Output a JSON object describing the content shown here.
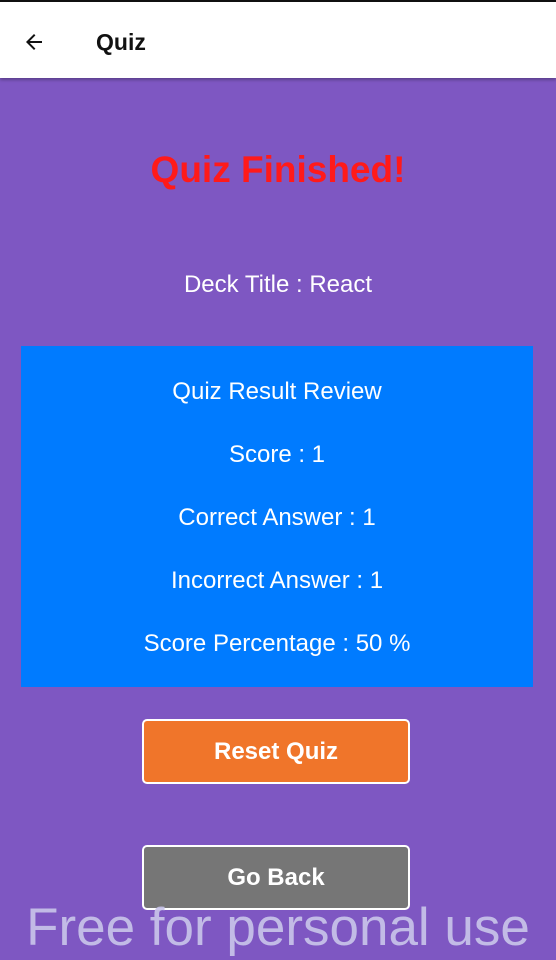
{
  "header": {
    "back_icon": "arrow-left-icon",
    "title": "Quiz"
  },
  "main": {
    "heading": "Quiz Finished!",
    "deck_title": "Deck Title : React",
    "result": {
      "title": "Quiz Result Review",
      "score": "Score : 1",
      "correct": "Correct Answer : 1",
      "incorrect": "Incorrect Answer : 1",
      "percentage": "Score Percentage : 50 %"
    },
    "buttons": {
      "reset_label": "Reset Quiz",
      "back_label": "Go Back"
    }
  },
  "watermark": "Free for personal use",
  "colors": {
    "background": "#7e57c2",
    "heading": "#ff1a1a",
    "result_box": "#007bff",
    "reset_button": "#f0752a",
    "back_button": "#767676"
  }
}
